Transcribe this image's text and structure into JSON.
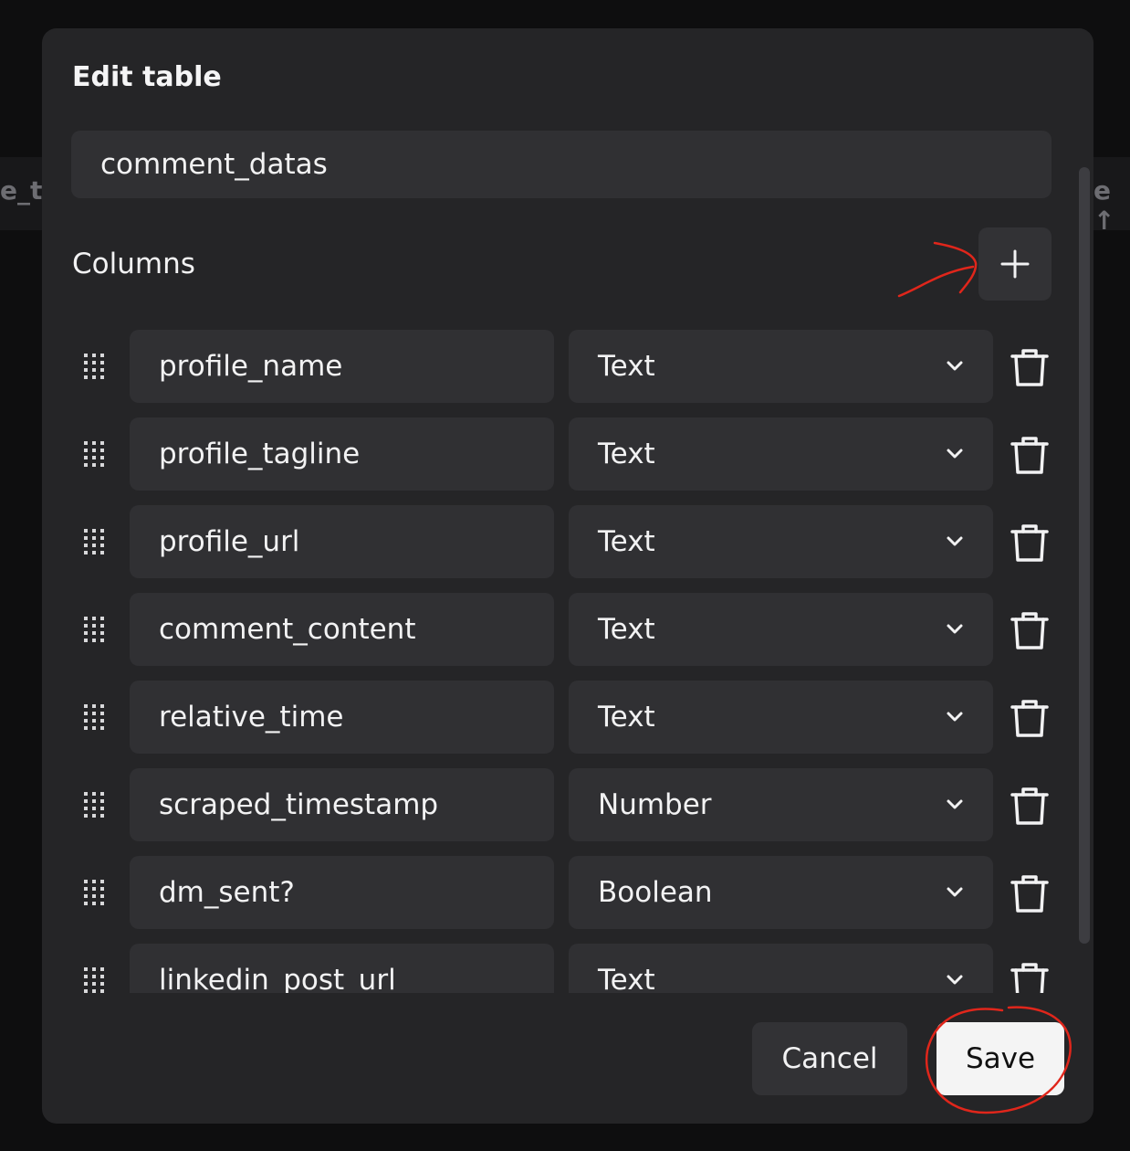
{
  "background": {
    "left_text": "e_t",
    "right_text": "e ↑"
  },
  "modal": {
    "title": "Edit table",
    "table_name": "comment_datas",
    "columns_label": "Columns",
    "add_icon": "plus-icon",
    "cancel_label": "Cancel",
    "save_label": "Save"
  },
  "columns": [
    {
      "name": "profile_name",
      "type": "Text"
    },
    {
      "name": "profile_tagline",
      "type": "Text"
    },
    {
      "name": "profile_url",
      "type": "Text"
    },
    {
      "name": "comment_content",
      "type": "Text"
    },
    {
      "name": "relative_time",
      "type": "Text"
    },
    {
      "name": "scraped_timestamp",
      "type": "Number"
    },
    {
      "name": "dm_sent?",
      "type": "Boolean"
    },
    {
      "name": "linkedin_post_url",
      "type": "Text"
    }
  ],
  "icons": {
    "drag": "drag-handle-icon",
    "chevron": "chevron-down-icon",
    "trash": "trash-icon"
  },
  "colors": {
    "annotation": "#e0261b",
    "modal_bg": "#252527",
    "field_bg": "#303033",
    "save_bg": "#f4f4f4"
  }
}
